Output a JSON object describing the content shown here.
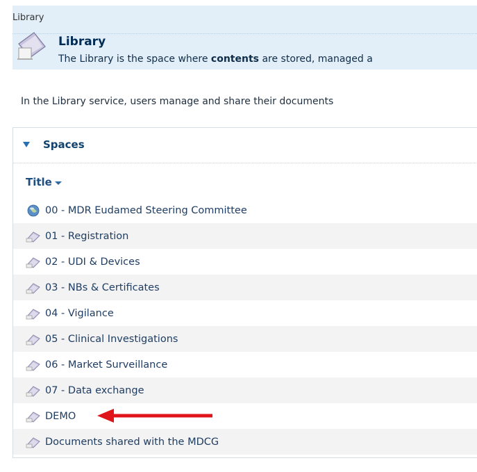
{
  "header": {
    "breadcrumb": "Library",
    "title": "Library",
    "description_pre": "The Library is the space where ",
    "description_bold": "contents",
    "description_post": " are stored, managed a"
  },
  "intro_text": "In the Library service, users manage and share their documents",
  "panel": {
    "title": "Spaces",
    "column_header": "Title"
  },
  "spaces": [
    {
      "label": "00 - MDR Eudamed Steering Committee",
      "icon": "globe-icon"
    },
    {
      "label": "01 - Registration",
      "icon": "folder-icon"
    },
    {
      "label": "02 - UDI & Devices",
      "icon": "folder-icon"
    },
    {
      "label": "03 - NBs & Certificates",
      "icon": "folder-icon"
    },
    {
      "label": "04 - Vigilance",
      "icon": "folder-icon"
    },
    {
      "label": "05 - Clinical Investigations",
      "icon": "folder-icon"
    },
    {
      "label": "06 - Market Surveillance",
      "icon": "folder-icon"
    },
    {
      "label": "07 - Data exchange",
      "icon": "folder-icon"
    },
    {
      "label": "DEMO",
      "icon": "folder-icon"
    },
    {
      "label": "Documents shared with the MDCG",
      "icon": "folder-icon"
    }
  ],
  "colors": {
    "header_band": "#e2eff8",
    "link": "#1f3d62",
    "arrow": "#e0141b"
  }
}
